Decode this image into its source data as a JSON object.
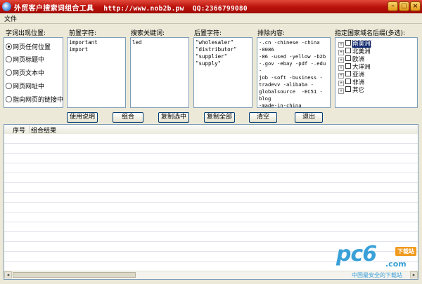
{
  "window": {
    "title": "外贸客户搜索词组合工具",
    "url": "http://www.nob2b.pw",
    "qq": "QQ:2366799080"
  },
  "menu": {
    "file": "文件"
  },
  "labels": {
    "position": "字词出现位置:",
    "prefix": "前置字符:",
    "keyword": "搜索关键词:",
    "suffix": "后置字符:",
    "exclude": "排除内容:",
    "domains": "指定国家域名后缀(多选):"
  },
  "positions": [
    {
      "label": "网页任何位置",
      "selected": true
    },
    {
      "label": "网页标题中",
      "selected": false
    },
    {
      "label": "网页文本中",
      "selected": false
    },
    {
      "label": "网页网址中",
      "selected": false
    },
    {
      "label": "指向网页的链接中",
      "selected": false
    }
  ],
  "fields": {
    "prefix": "important\nimport",
    "keyword": "led",
    "suffix": "\"wholesaler\"\n\"distributor\"\n\"supplier\"\n\"supply\"",
    "exclude": "-.cn -chinese -china -0086\n-86 -used -yellow -b2b\n-.gov -ebay -pdf -.edu -\njob -soft -business -\ntradevv -alibaba -\nglobalsource  -EC51 -blog\n-made-in-china"
  },
  "domain_tree": [
    {
      "label": "南美洲",
      "selected": true
    },
    {
      "label": "北美洲",
      "selected": false
    },
    {
      "label": "欧洲",
      "selected": false
    },
    {
      "label": "大洋洲",
      "selected": false
    },
    {
      "label": "亚洲",
      "selected": false
    },
    {
      "label": "非洲",
      "selected": false
    },
    {
      "label": "其它",
      "selected": false
    }
  ],
  "buttons": {
    "help": "使用说明",
    "combine": "组合",
    "copy_selected": "复制选中",
    "copy_all": "复制全部",
    "clear": "清空",
    "exit": "退出"
  },
  "results": {
    "columns": [
      "序号",
      "组合结果"
    ],
    "rows": []
  },
  "watermark": {
    "logo": "pc6",
    "badge": "下载站",
    "domain": ".com",
    "slogan": "中国最安全的下载站"
  }
}
